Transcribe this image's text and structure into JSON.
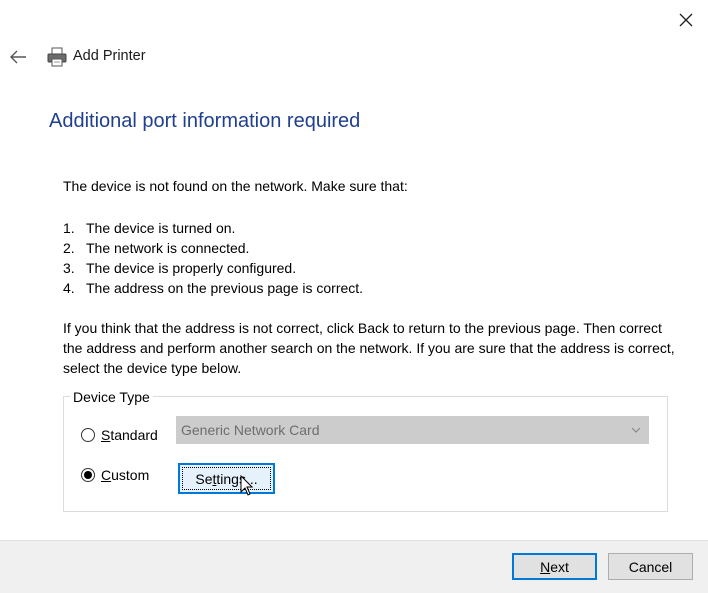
{
  "window": {
    "title": "Add Printer",
    "close_symbol": "✕"
  },
  "heading": "Additional port information required",
  "intro": "The device is not found on the network. Make sure that:",
  "steps": [
    {
      "num": "1.",
      "text": "The device is turned on."
    },
    {
      "num": "2.",
      "text": "The network is connected."
    },
    {
      "num": "3.",
      "text": "The device is properly configured."
    },
    {
      "num": "4.",
      "text": "The address on the previous page is correct."
    }
  ],
  "note": "If you think that the address is not correct, click Back to return to the previous page. Then correct the address and perform another search on the network. If you are sure that the address is correct, select the device type below.",
  "device_type": {
    "legend": "Device Type",
    "standard": {
      "label_access": "S",
      "label_rest": "tandard",
      "selected": false
    },
    "custom": {
      "label_access": "C",
      "label_rest": "ustom",
      "selected": true
    },
    "combo_value": "Generic Network Card",
    "settings_label_pre": "Se",
    "settings_label_access": "t",
    "settings_label_post": "tings..."
  },
  "footer": {
    "next_access": "N",
    "next_rest": "ext",
    "cancel": "Cancel"
  },
  "icons": {
    "back": "back-arrow-icon",
    "printer": "printer-icon",
    "close": "close-icon",
    "chevron": "chevron-down-icon",
    "cursor": "mouse-cursor-icon"
  },
  "colors": {
    "heading": "#1f3f8f",
    "accent": "#0078d7",
    "footer_bg": "#f0f0f0",
    "disabled_combo": "#cccccc"
  }
}
